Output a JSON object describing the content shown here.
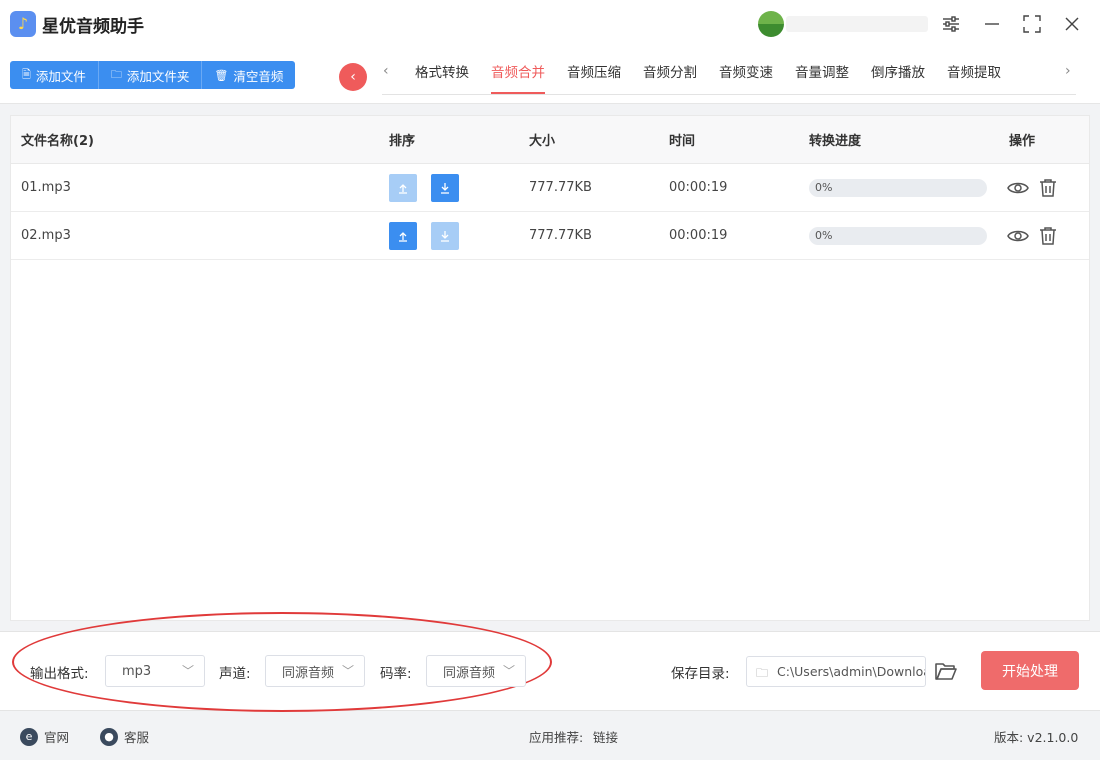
{
  "app": {
    "title": "星优音频助手",
    "logo_icon": "music-note-icon"
  },
  "window_controls": [
    "settings-sliders-icon",
    "minimize-icon",
    "maximize-icon",
    "close-icon"
  ],
  "toolbar": {
    "add_file": "添加文件",
    "add_folder": "添加文件夹",
    "clear_audio": "清空音频"
  },
  "tabs": [
    {
      "label": "格式转换"
    },
    {
      "label": "音频合并"
    },
    {
      "label": "音频压缩"
    },
    {
      "label": "音频分割"
    },
    {
      "label": "音频变速"
    },
    {
      "label": "音量调整"
    },
    {
      "label": "倒序播放"
    },
    {
      "label": "音频提取"
    }
  ],
  "active_tab": "音频合并",
  "table": {
    "headers": {
      "name": "文件名称(2)",
      "sort": "排序",
      "size": "大小",
      "time": "时间",
      "progress": "转换进度",
      "ops": "操作"
    },
    "rows": [
      {
        "name": "01.mp3",
        "size": "777.77KB",
        "time": "00:00:19",
        "progress_text": "0%",
        "progress": 0,
        "up_enabled": false,
        "down_enabled": true
      },
      {
        "name": "02.mp3",
        "size": "777.77KB",
        "time": "00:00:19",
        "progress_text": "0%",
        "progress": 0,
        "up_enabled": true,
        "down_enabled": false
      }
    ]
  },
  "settings": {
    "format_label": "输出格式:",
    "format_value": "mp3",
    "channel_label": "声道:",
    "channel_value": "同源音频",
    "bitrate_label": "码率:",
    "bitrate_value": "同源音频",
    "save_label": "保存目录:",
    "save_path": "C:\\Users\\admin\\Downloads",
    "start_label": "开始处理"
  },
  "statusbar": {
    "website": "官网",
    "service": "客服",
    "recommend_label": "应用推荐:",
    "recommend_link": "链接",
    "version": "版本: v2.1.0.0"
  },
  "colors": {
    "primary": "#3b8ef0",
    "accent": "#ef5b5b",
    "start_button": "#ef6b6b"
  }
}
